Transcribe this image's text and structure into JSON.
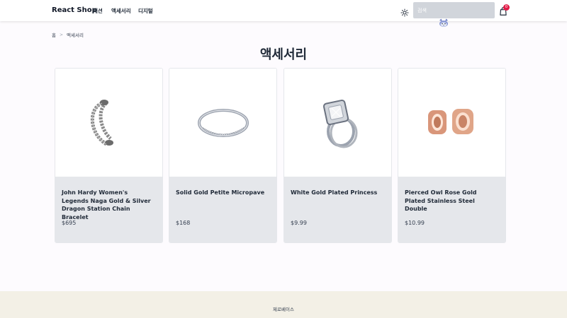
{
  "navbar": {
    "brand": "React Shop",
    "links": [
      "패션",
      "액세서리",
      "디지털"
    ],
    "search_placeholder": "검색",
    "cart_count": "0"
  },
  "breadcrumb": {
    "home": "홈",
    "separator": ">",
    "current": "액세서리"
  },
  "page": {
    "title": "액세서리"
  },
  "products": [
    {
      "title": "John Hardy Women's Legends Naga Gold & Silver Dragon Station Chain Bracelet",
      "price": "$695",
      "image_icon": "dragon-bracelet-icon"
    },
    {
      "title": "Solid Gold Petite Micropave",
      "price": "$168",
      "image_icon": "micropave-ring-icon"
    },
    {
      "title": "White Gold Plated Princess",
      "price": "$9.99",
      "image_icon": "princess-ring-icon"
    },
    {
      "title": "Pierced Owl Rose Gold Plated Stainless Steel Double",
      "price": "$10.99",
      "image_icon": "rose-gold-plugs-icon"
    }
  ],
  "footer": {
    "text": "제로베이스"
  },
  "colors": {
    "badge": "#e11d48",
    "card_body": "#e5e7eb",
    "search_bg": "#d1d5db",
    "footer_bg": "#f3f0e6",
    "rose_gold": "#d9967a"
  }
}
